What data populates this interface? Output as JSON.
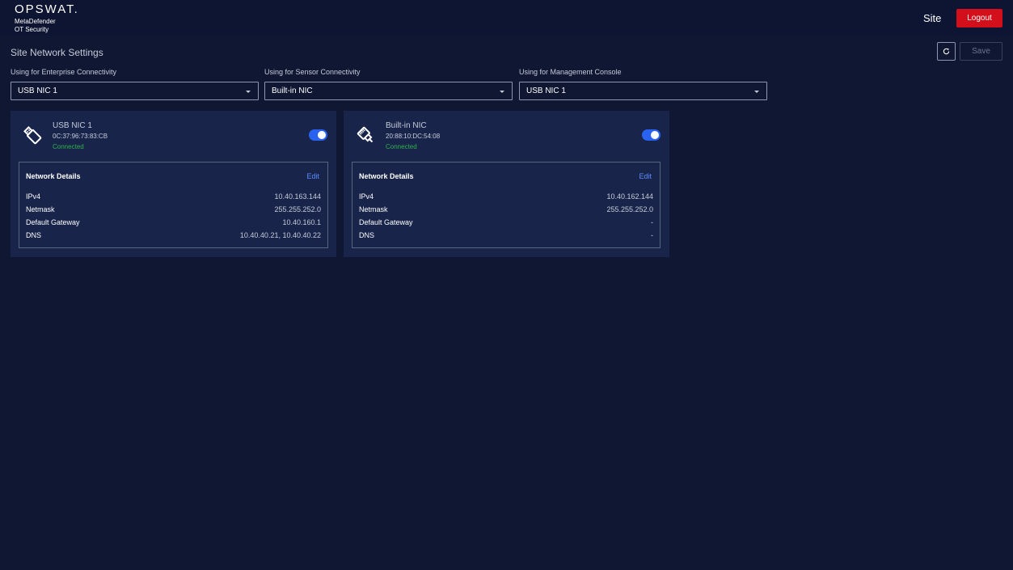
{
  "header": {
    "brand": "OPSWAT.",
    "product_line1": "MetaDefender",
    "product_line2": "OT Security",
    "site_label": "Site",
    "logout_label": "Logout"
  },
  "page": {
    "title": "Site Network Settings",
    "save_label": "Save"
  },
  "selects": [
    {
      "label": "Using for Enterprise Connectivity",
      "value": "USB NIC 1"
    },
    {
      "label": "Using for Sensor Connectivity",
      "value": "Built-in NIC"
    },
    {
      "label": "Using for Management Console",
      "value": "USB NIC 1"
    }
  ],
  "nics": [
    {
      "name": "USB NIC 1",
      "mac": "0C:37:96:73:83:CB",
      "status": "Connected",
      "enabled": true,
      "icon": "usb-icon",
      "details_title": "Network Details",
      "edit_label": "Edit",
      "rows": [
        {
          "key": "IPv4",
          "value": "10.40.163.144"
        },
        {
          "key": "Netmask",
          "value": "255.255.252.0"
        },
        {
          "key": "Default Gateway",
          "value": "10.40.160.1"
        },
        {
          "key": "DNS",
          "value": "10.40.40.21, 10.40.40.22"
        }
      ]
    },
    {
      "name": "Built-in NIC",
      "mac": "20:88:10:DC:54:08",
      "status": "Connected",
      "enabled": true,
      "icon": "ethernet-icon",
      "details_title": "Network Details",
      "edit_label": "Edit",
      "rows": [
        {
          "key": "IPv4",
          "value": "10.40.162.144"
        },
        {
          "key": "Netmask",
          "value": "255.255.252.0"
        },
        {
          "key": "Default Gateway",
          "value": "-"
        },
        {
          "key": "DNS",
          "value": "-"
        }
      ]
    }
  ],
  "colors": {
    "background": "#0f1733",
    "card": "#18244a",
    "logout": "#d30f1b",
    "toggle_on": "#2a62f0",
    "connected": "#2fb24a",
    "link": "#5e8eff"
  }
}
